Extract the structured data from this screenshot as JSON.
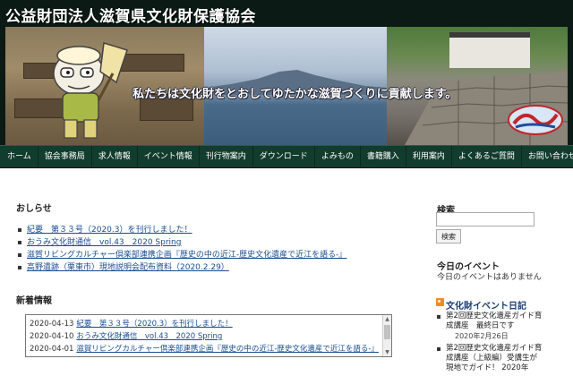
{
  "header": {
    "site_title": "公益財団法人滋賀県文化財保護協会",
    "tagline": "私たちは文化財をとおしてゆたかな滋賀づくりに貢献します。"
  },
  "nav": {
    "items": [
      "ホーム",
      "協会事務局",
      "求人情報",
      "イベント情報",
      "刊行物案内",
      "ダウンロード",
      "よみもの",
      "書籍購入",
      "利用案内",
      "よくあるご質問",
      "お問い合わせ"
    ]
  },
  "news": {
    "title": "おしらせ",
    "items": [
      "紀要　第３３号（2020.3）を刊行しました！",
      "おうみ文化財通信　vol.43　2020 Spring",
      "滋賀リビングカルチャー倶楽部連携企画『歴史の中の近江-歴史文化遺産で近江を語る-』",
      "高野遺跡（栗東市）現地説明会配布資料（2020.2.29）"
    ]
  },
  "latest": {
    "title": "新着情報",
    "rows": [
      {
        "date": "2020-04-13",
        "text": "紀要　第３３号（2020.3）を刊行しました！"
      },
      {
        "date": "2020-04-10",
        "text": "おうみ文化財通信　vol.43　2020 Spring"
      },
      {
        "date": "2020-04-01",
        "text": "滋賀リビングカルチャー倶楽部連携企画『歴史の中の近江-歴史文化遺産で近江を語る-』"
      }
    ]
  },
  "sidebar": {
    "search_label": "検索",
    "search_placeholder": "",
    "search_button": "検索",
    "events_title": "今日のイベント",
    "events_empty": "今日のイベントはありません",
    "rss_title": "文化財イベント日記",
    "diary": [
      {
        "text": "第2回歴史文化遺産ガイド育成講座　最終日です",
        "date": "2020年2月26日"
      },
      {
        "text": "第2回歴史文化遺産ガイド育成講座（上級編）受講生が現地でガイド！ 2020年",
        "date": ""
      }
    ]
  },
  "colors": {
    "header_bg": "#0b1a14",
    "nav_bg": "#123c2e",
    "link": "#1a4d8f",
    "rss": "#f08a24"
  }
}
